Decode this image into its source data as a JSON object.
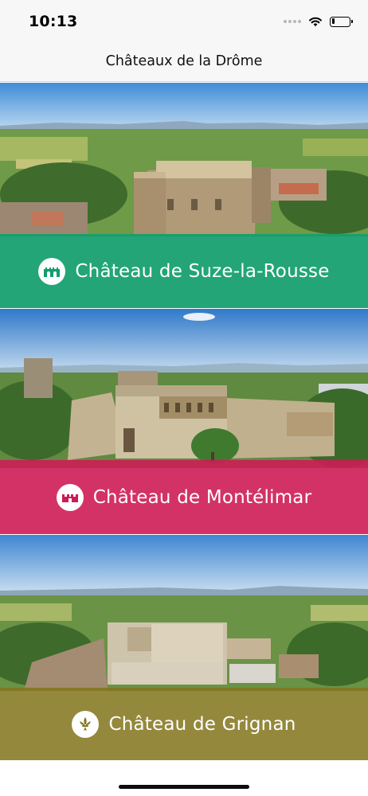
{
  "status_bar": {
    "time": "10:13",
    "icons": [
      "cellular-signal-icon",
      "wifi-icon",
      "battery-icon"
    ]
  },
  "nav": {
    "title": "Châteaux de la Drôme"
  },
  "cards": [
    {
      "title": "Château de Suze-la-Rousse",
      "color": "#129e6e",
      "icon": "castle-arches-icon"
    },
    {
      "title": "Château de Montélimar",
      "color": "#ce1c56",
      "icon": "castle-battlements-icon"
    },
    {
      "title": "Château de Grignan",
      "color": "#82741c",
      "icon": "fleur-de-lis-icon"
    }
  ],
  "colors": {
    "nav_background": "#f7f7f7",
    "banner_text": "#ffffff"
  }
}
